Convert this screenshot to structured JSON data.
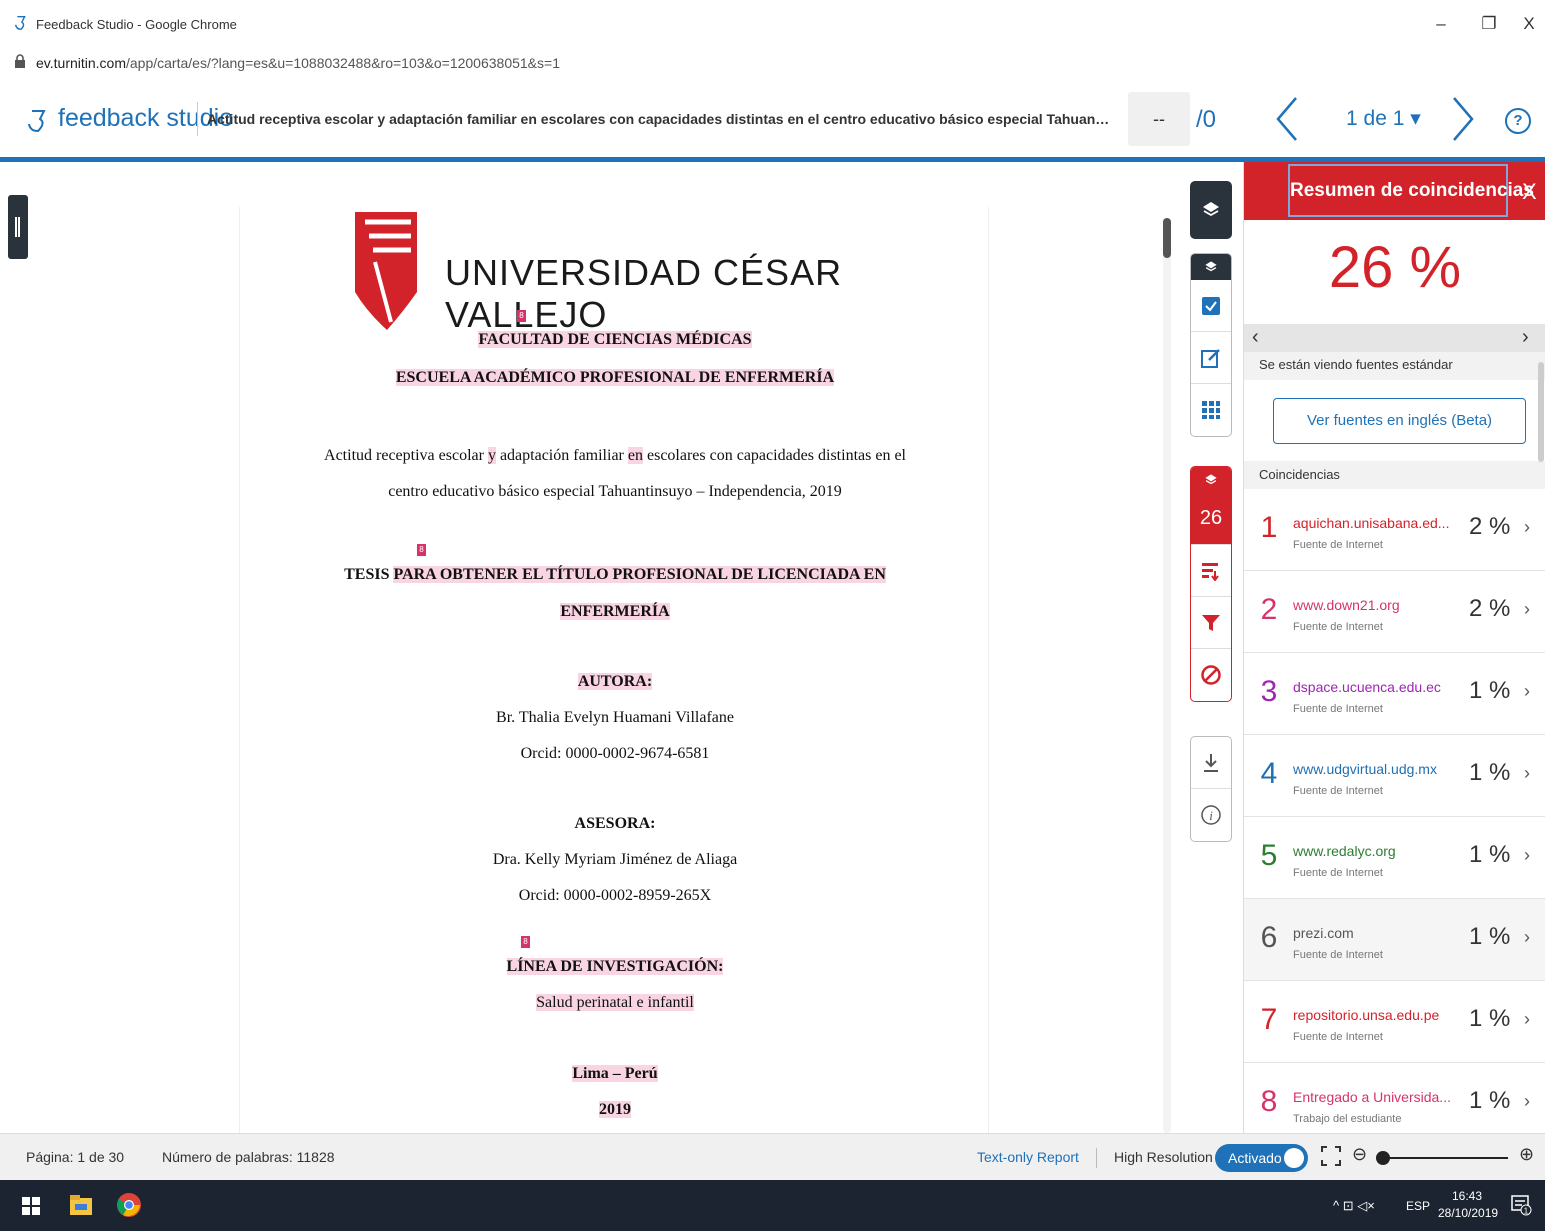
{
  "window": {
    "title": "Feedback Studio - Google Chrome",
    "url_host": "ev.turnitin.com",
    "url_path": "/app/carta/es/?lang=es&u=1088032488&ro=103&o=1200638051&s=1"
  },
  "header": {
    "logo": "feedback studio",
    "doc_title": "Actitud receptiva escolar y adaptación familiar en escolares con capacidades distintas en el centro educativo básico especial Tahuantinsuyo – Independencia, 2...",
    "grade": "--",
    "grade_total": "/0",
    "page_of": "1 de 1 ▾"
  },
  "document": {
    "university": "UNIVERSIDAD CÉSAR VALLEJO",
    "faculty": "FACULTAD DE CIENCIAS MÉDICAS",
    "school": "ESCUELA ACADÉMICO PROFESIONAL DE ENFERMERÍA",
    "title_p1": "Actitud receptiva escolar ",
    "title_y": "y",
    "title_p2": " adaptación familiar ",
    "title_en": "en",
    "title_p3": " escolares con capacidades distintas en el",
    "title_line2": "centro educativo básico especial Tahuantinsuyo – Independencia, 2019",
    "tesis_a": "TESIS ",
    "tesis_b": "PARA OBTENER EL TÍTULO PROFESIONAL DE LICENCIADA EN",
    "tesis_c": "ENFERMERÍA",
    "autora_label": "AUTORA:",
    "autora_name": "Br. Thalia Evelyn Huamani Villafane",
    "autora_orcid": "Orcid: 0000-0002-9674-6581",
    "asesora_label": "ASESORA:",
    "asesora_name": "Dra. Kelly Myriam Jiménez de Aliaga",
    "asesora_orcid": "Orcid: 0000-0002-8959-265X",
    "linea_label": "LÍNEA DE INVESTIGACIÓN:",
    "linea_value": "Salud perinatal e infantil",
    "place": "Lima – Perú",
    "year": "2019",
    "match_marker": "8"
  },
  "tools": {
    "similarity_count": "26"
  },
  "panel": {
    "title": "Resumen de coincidencias",
    "close": "X",
    "percent": "26 %",
    "source_note": "Se están viendo fuentes estándar",
    "beta_button": "Ver fuentes en inglés (Beta)",
    "matches_label": "Coincidencias",
    "matches": [
      {
        "num": "1",
        "source": "aquichan.unisabana.ed...",
        "type": "Fuente de Internet",
        "pct": "2 %",
        "color": "#d2232a"
      },
      {
        "num": "2",
        "source": "www.down21.org",
        "type": "Fuente de Internet",
        "pct": "2 %",
        "color": "#d6336c"
      },
      {
        "num": "3",
        "source": "dspace.ucuenca.edu.ec",
        "type": "Fuente de Internet",
        "pct": "1 %",
        "color": "#9c27b0"
      },
      {
        "num": "4",
        "source": "www.udgvirtual.udg.mx",
        "type": "Fuente de Internet",
        "pct": "1 %",
        "color": "#1f6fb2"
      },
      {
        "num": "5",
        "source": "www.redalyc.org",
        "type": "Fuente de Internet",
        "pct": "1 %",
        "color": "#2e7d32"
      },
      {
        "num": "6",
        "source": "prezi.com",
        "type": "Fuente de Internet",
        "pct": "1 %",
        "color": "#555555"
      },
      {
        "num": "7",
        "source": "repositorio.unsa.edu.pe",
        "type": "Fuente de Internet",
        "pct": "1 %",
        "color": "#d2232a"
      },
      {
        "num": "8",
        "source": "Entregado a Universida...",
        "type": "Trabajo del estudiante",
        "pct": "1 %",
        "color": "#d6336c"
      }
    ]
  },
  "statusbar": {
    "page": "Página: 1 de 30",
    "words": "Número de palabras: 11828",
    "text_only": "Text-only Report",
    "high_res": "High Resolution",
    "toggle": "Activado",
    "zoom_fraction": 0.05
  },
  "taskbar": {
    "lang": "ESP",
    "time": "16:43",
    "date": "28/10/2019",
    "tray": "^ ⊡ ◁×",
    "notif_count": "1"
  }
}
